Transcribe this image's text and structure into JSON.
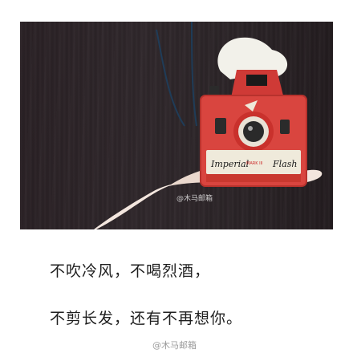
{
  "photo": {
    "description_icon": "camera-in-hand-photo",
    "camera_brand": "Imperial",
    "camera_model": "MARK III",
    "camera_flash": "Flash",
    "watermark": "@木马邮箱",
    "colors": {
      "wall": "#2b2327",
      "camera_body": "#d9453f",
      "hand": "#f3e6de"
    }
  },
  "text": {
    "line1": "不吹冷风，不喝烈酒，",
    "line2": "不剪长发，还有不再想你。"
  },
  "watermark": "@木马邮箱"
}
